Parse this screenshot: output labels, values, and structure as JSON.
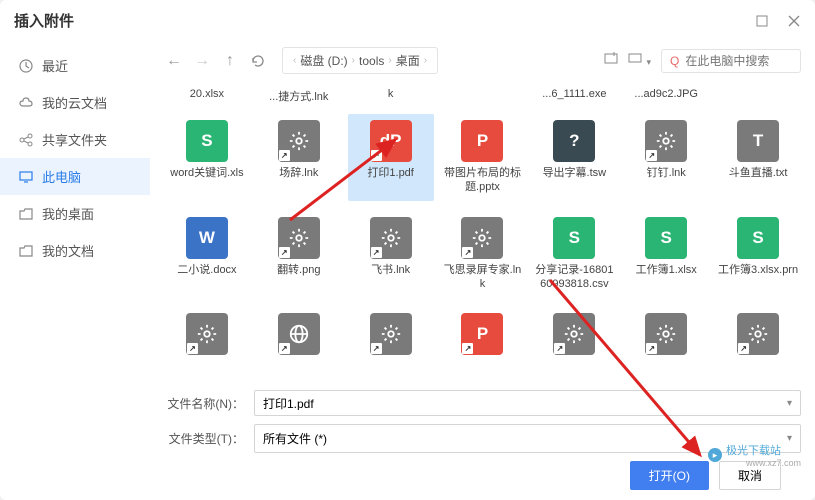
{
  "title": "插入附件",
  "sidebar": {
    "items": [
      {
        "label": "最近",
        "icon": "clock"
      },
      {
        "label": "我的云文档",
        "icon": "cloud"
      },
      {
        "label": "共享文件夹",
        "icon": "share"
      },
      {
        "label": "此电脑",
        "icon": "monitor",
        "active": true
      },
      {
        "label": "我的桌面",
        "icon": "folder"
      },
      {
        "label": "我的文档",
        "icon": "folder"
      }
    ]
  },
  "breadcrumb": [
    "磁盘 (D:)",
    "tools",
    "桌面"
  ],
  "search_placeholder": "在此电脑中搜索",
  "truncated_labels": [
    "20.xlsx",
    "...捷方式.lnk",
    "k",
    "",
    "...6_1111.exe",
    "...ad9c2.JPG",
    ""
  ],
  "files": [
    {
      "name": "word关键词.xls",
      "icon": "S",
      "color": "green"
    },
    {
      "name": "场辞.lnk",
      "icon": "gear",
      "color": "gray",
      "shortcut": true
    },
    {
      "name": "打印1.pdf",
      "icon": "P",
      "color": "red",
      "shortcut": true,
      "selected": true,
      "pglyph": "dP"
    },
    {
      "name": "带图片布局的标题.pptx",
      "icon": "P",
      "color": "red"
    },
    {
      "name": "导出字幕.tsw",
      "icon": "?",
      "color": "teal"
    },
    {
      "name": "钉钉.lnk",
      "icon": "gear",
      "color": "gray",
      "shortcut": true
    },
    {
      "name": "斗鱼直播.txt",
      "icon": "T",
      "color": "gray"
    },
    {
      "name": "二小说.docx",
      "icon": "W",
      "color": "blue"
    },
    {
      "name": "翻转.png",
      "icon": "gear",
      "color": "gray",
      "shortcut": true
    },
    {
      "name": "飞书.lnk",
      "icon": "gear",
      "color": "gray",
      "shortcut": true
    },
    {
      "name": "飞思录屏专家.lnk",
      "icon": "gear",
      "color": "gray",
      "shortcut": true
    },
    {
      "name": "分享记录-1680160993818.csv",
      "icon": "S",
      "color": "green"
    },
    {
      "name": "工作簿1.xlsx",
      "icon": "S",
      "color": "green"
    },
    {
      "name": "工作簿3.xlsx.prn",
      "icon": "S",
      "color": "green"
    },
    {
      "name": "",
      "icon": "gear",
      "color": "gray",
      "shortcut": true
    },
    {
      "name": "",
      "icon": "globe",
      "color": "gray",
      "shortcut": true
    },
    {
      "name": "",
      "icon": "gear",
      "color": "gray",
      "shortcut": true
    },
    {
      "name": "",
      "icon": "P",
      "color": "red",
      "shortcut": true
    },
    {
      "name": "",
      "icon": "gear",
      "color": "gray",
      "shortcut": true
    },
    {
      "name": "",
      "icon": "gear",
      "color": "gray",
      "shortcut": true
    },
    {
      "name": "",
      "icon": "gear",
      "color": "gray",
      "shortcut": true
    }
  ],
  "filename_label": "文件名称(N)：",
  "filename_value": "打印1.pdf",
  "filetype_label": "文件类型(T)：",
  "filetype_value": "所有文件 (*)",
  "open_label": "打开(O)",
  "cancel_label": "取消",
  "watermark_text": "极光下载站",
  "watermark_url": "www.xz7.com"
}
